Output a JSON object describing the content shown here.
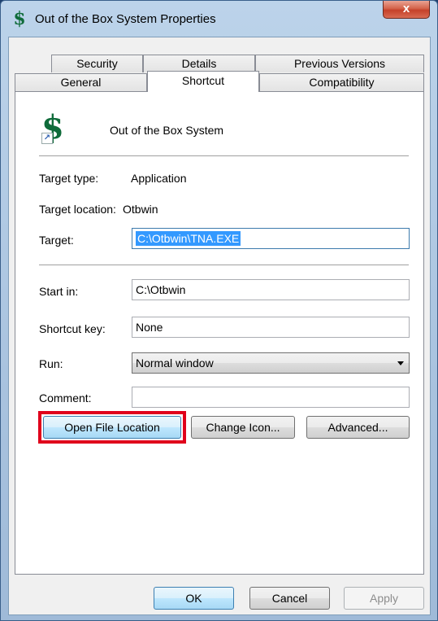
{
  "window": {
    "title": "Out of the Box System Properties",
    "close_glyph": "x",
    "app_icon_glyph": "$"
  },
  "tabs": {
    "row_back": [
      "Security",
      "Details",
      "Previous Versions"
    ],
    "row_front": [
      "General",
      "Shortcut",
      "Compatibility"
    ],
    "active": "Shortcut"
  },
  "shortcut": {
    "icon_glyph": "$",
    "name": "Out of the Box System",
    "target_type_label": "Target type:",
    "target_type_value": "Application",
    "target_location_label": "Target location:",
    "target_location_value": "Otbwin",
    "target_label": "Target:",
    "target_value": "C:\\Otbwin\\TNA.EXE",
    "start_in_label": "Start in:",
    "start_in_value": "C:\\Otbwin",
    "shortcut_key_label": "Shortcut key:",
    "shortcut_key_value": "None",
    "run_label": "Run:",
    "run_value": "Normal window",
    "comment_label": "Comment:",
    "comment_value": ""
  },
  "buttons": {
    "open_file_location": "Open File Location",
    "change_icon": "Change Icon...",
    "advanced": "Advanced...",
    "ok": "OK",
    "cancel": "Cancel",
    "apply": "Apply"
  },
  "colors": {
    "highlight": "#e0001b",
    "selection": "#3399ff",
    "icon_green": "#0f6b3a"
  }
}
